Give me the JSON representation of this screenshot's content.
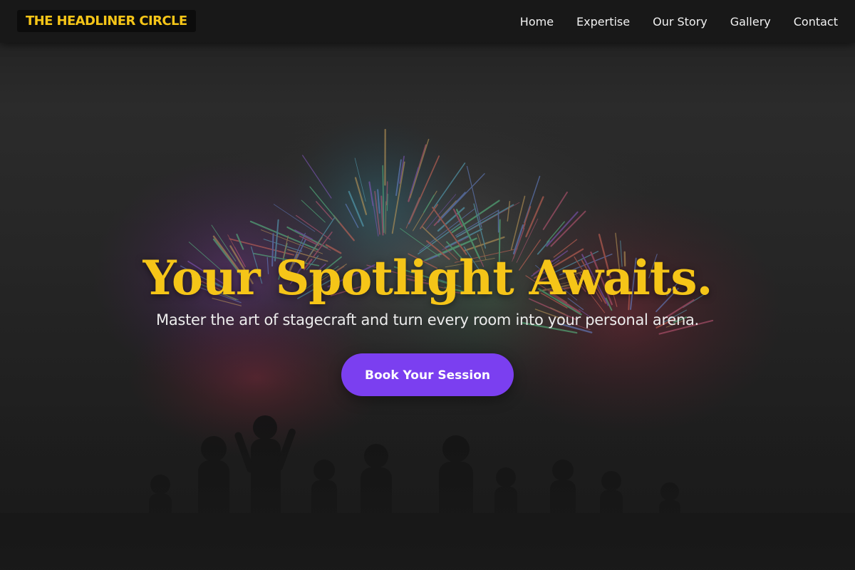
{
  "brand": {
    "name": "THE HEADLINER CIRCLE",
    "accent_color": "#f5c518"
  },
  "nav": {
    "items": [
      {
        "label": "Home"
      },
      {
        "label": "Expertise"
      },
      {
        "label": "Our Story"
      },
      {
        "label": "Gallery"
      },
      {
        "label": "Contact"
      }
    ]
  },
  "hero": {
    "background": "fireworks-over-crowd-image",
    "title": "Your Spotlight Awaits.",
    "subtitle": "Master the art of stagecraft and turn every room into your personal arena.",
    "cta_label": "Book Your Session",
    "cta_color": "#7b3ff0"
  }
}
